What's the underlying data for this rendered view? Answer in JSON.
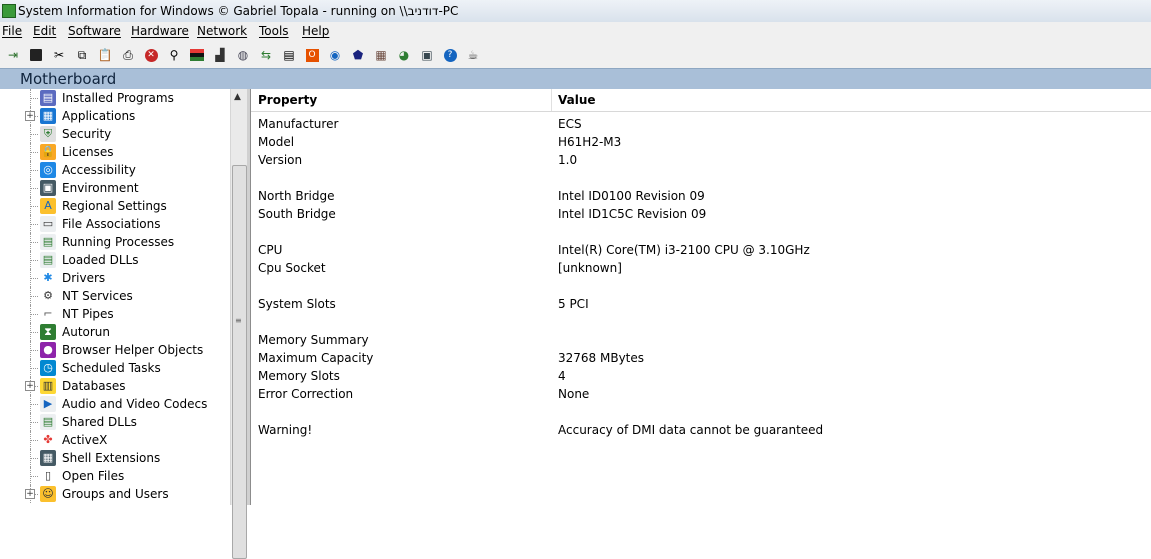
{
  "window": {
    "title": "System Information for Windows  © Gabriel Topala - running on \\\\דודניב-PC"
  },
  "menu": [
    "File",
    "Edit",
    "Software",
    "Hardware",
    "Network",
    "Tools",
    "Help"
  ],
  "toolbar_icons": [
    "exit-icon",
    "save-icon",
    "cut-icon",
    "copy-icon",
    "paste-icon",
    "print-icon",
    "stop-icon",
    "find-icon",
    "flag-icon",
    "chart-icon",
    "network-icon",
    "refresh-icon",
    "document-icon",
    "office-icon",
    "ie-icon",
    "shield-icon",
    "grid-icon",
    "globe-icon",
    "monitor-icon",
    "help-icon",
    "coffee-icon"
  ],
  "section_header": "Motherboard",
  "sidebar": {
    "items": [
      {
        "label": "Installed Programs",
        "icon": "installed-programs-icon",
        "expander": false
      },
      {
        "label": "Applications",
        "icon": "applications-icon",
        "expander": true
      },
      {
        "label": "Security",
        "icon": "security-icon",
        "expander": false
      },
      {
        "label": "Licenses",
        "icon": "licenses-icon",
        "expander": false
      },
      {
        "label": "Accessibility",
        "icon": "accessibility-icon",
        "expander": false
      },
      {
        "label": "Environment",
        "icon": "environment-icon",
        "expander": false
      },
      {
        "label": "Regional Settings",
        "icon": "regional-settings-icon",
        "expander": false
      },
      {
        "label": "File Associations",
        "icon": "file-associations-icon",
        "expander": false
      },
      {
        "label": "Running Processes",
        "icon": "running-processes-icon",
        "expander": false
      },
      {
        "label": "Loaded DLLs",
        "icon": "loaded-dlls-icon",
        "expander": false
      },
      {
        "label": "Drivers",
        "icon": "drivers-icon",
        "expander": false
      },
      {
        "label": "NT Services",
        "icon": "nt-services-icon",
        "expander": false
      },
      {
        "label": "NT Pipes",
        "icon": "nt-pipes-icon",
        "expander": false
      },
      {
        "label": "Autorun",
        "icon": "autorun-icon",
        "expander": false
      },
      {
        "label": "Browser Helper Objects",
        "icon": "browser-helper-objects-icon",
        "expander": false
      },
      {
        "label": "Scheduled Tasks",
        "icon": "scheduled-tasks-icon",
        "expander": false
      },
      {
        "label": "Databases",
        "icon": "databases-icon",
        "expander": true
      },
      {
        "label": "Audio and Video Codecs",
        "icon": "codecs-icon",
        "expander": false
      },
      {
        "label": "Shared DLLs",
        "icon": "shared-dlls-icon",
        "expander": false
      },
      {
        "label": "ActiveX",
        "icon": "activex-icon",
        "expander": false
      },
      {
        "label": "Shell Extensions",
        "icon": "shell-extensions-icon",
        "expander": false
      },
      {
        "label": "Open Files",
        "icon": "open-files-icon",
        "expander": false
      },
      {
        "label": "Groups and Users",
        "icon": "groups-and-users-icon",
        "expander": true
      }
    ]
  },
  "table": {
    "headers": {
      "property": "Property",
      "value": "Value"
    },
    "rows": [
      {
        "property": "Manufacturer",
        "value": "ECS"
      },
      {
        "property": "Model",
        "value": "H61H2-M3"
      },
      {
        "property": "Version",
        "value": "1.0"
      },
      {
        "property": "",
        "value": ""
      },
      {
        "property": "North Bridge",
        "value": "Intel ID0100 Revision 09"
      },
      {
        "property": "South Bridge",
        "value": "Intel ID1C5C Revision 09"
      },
      {
        "property": "",
        "value": ""
      },
      {
        "property": "CPU",
        "value": "Intel(R) Core(TM) i3-2100 CPU @ 3.10GHz"
      },
      {
        "property": "Cpu Socket",
        "value": "[unknown]"
      },
      {
        "property": "",
        "value": ""
      },
      {
        "property": "System Slots",
        "value": "5 PCI"
      },
      {
        "property": "",
        "value": ""
      },
      {
        "property": "Memory Summary",
        "value": ""
      },
      {
        "property": "Maximum Capacity",
        "value": "32768 MBytes"
      },
      {
        "property": "Memory Slots",
        "value": "4"
      },
      {
        "property": "Error Correction",
        "value": "None"
      },
      {
        "property": "",
        "value": ""
      },
      {
        "property": "Warning!",
        "value": "Accuracy of DMI data cannot be guaranteed"
      }
    ]
  }
}
